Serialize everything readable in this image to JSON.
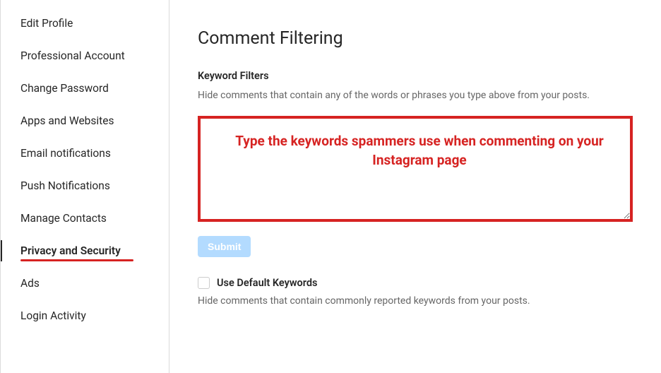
{
  "sidebar": {
    "items": [
      {
        "label": "Edit Profile"
      },
      {
        "label": "Professional Account"
      },
      {
        "label": "Change Password"
      },
      {
        "label": "Apps and Websites"
      },
      {
        "label": "Email notifications"
      },
      {
        "label": "Push Notifications"
      },
      {
        "label": "Manage Contacts"
      },
      {
        "label": "Privacy and Security"
      },
      {
        "label": "Ads"
      },
      {
        "label": "Login Activity"
      }
    ]
  },
  "main": {
    "title": "Comment Filtering",
    "keyword_filters": {
      "label": "Keyword Filters",
      "desc": "Hide comments that contain any of the words or phrases you type above from your posts.",
      "textarea_value": "",
      "annotation_text": "Type the keywords spammers use when commenting on your Instagram page",
      "submit_label": "Submit"
    },
    "default_keywords": {
      "checkbox_label": "Use Default Keywords",
      "desc": "Hide comments that contain commonly reported keywords from your posts."
    }
  }
}
